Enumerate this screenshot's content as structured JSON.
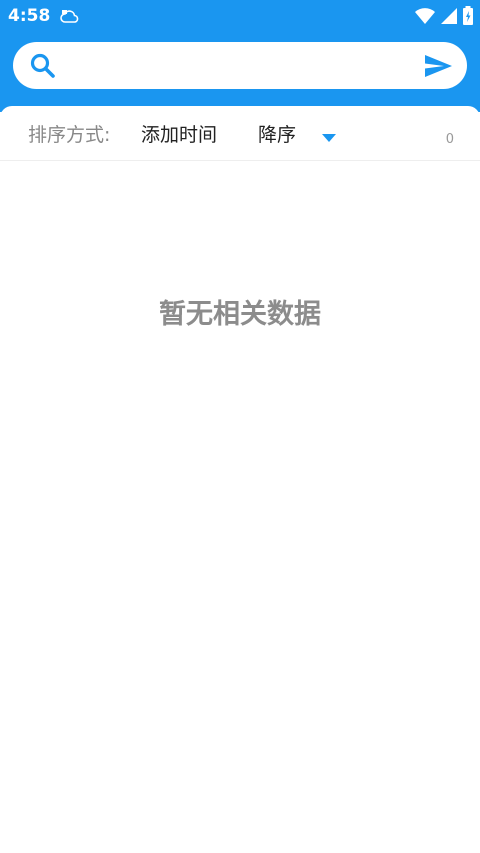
{
  "status_bar": {
    "time": "4:58"
  },
  "search": {
    "value": "",
    "placeholder": ""
  },
  "sort_bar": {
    "label": "排序方式:",
    "field": "添加时间",
    "order": "降序",
    "count": "0"
  },
  "empty_state": {
    "message": "暂无相关数据"
  },
  "colors": {
    "primary": "#1a96f0",
    "empty_text": "#8c8c8c"
  },
  "icons": {
    "search": "search-icon",
    "send": "send-icon",
    "caret": "caret-down-icon",
    "wifi": "wifi-icon",
    "signal": "signal-icon",
    "battery": "battery-icon",
    "notification": "cloud-notification-icon"
  }
}
